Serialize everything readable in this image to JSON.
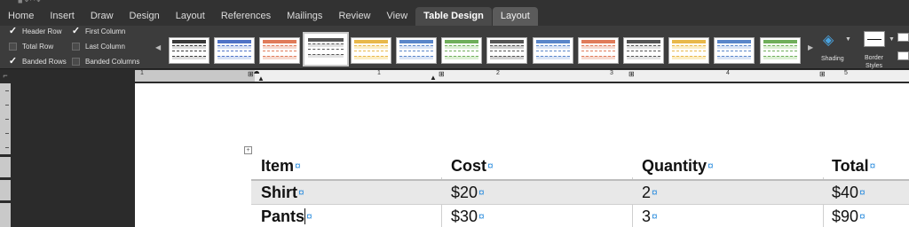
{
  "ribbon_tabs": [
    "Home",
    "Insert",
    "Draw",
    "Design",
    "Layout",
    "References",
    "Mailings",
    "Review",
    "View",
    "Table Design",
    "Layout"
  ],
  "active_tab": "Table Design",
  "table_style_options": {
    "header_row": "Header Row",
    "first_column": "First Column",
    "total_row": "Total Row",
    "last_column": "Last Column",
    "banded_rows": "Banded Rows",
    "banded_columns": "Banded Columns",
    "checked": [
      "Header Row",
      "First Column",
      "Banded Rows"
    ]
  },
  "table_styles": {
    "count": 14,
    "selected_index": 3,
    "row_colors": [
      "#3a3a3a",
      "#4f73c6",
      "#e07b5a",
      "#555555",
      "#e8b84a",
      "#5a86c9",
      "#6fae5a",
      "#555555",
      "#5a86c9",
      "#e07b5a",
      "#555555",
      "#e8b84a",
      "#5a86c9",
      "#6fae5a"
    ],
    "band_colors": [
      "#dcdcdc",
      "#d6e0f4",
      "#f6d9cf",
      "#e2e2e2",
      "#fbedc4",
      "#d9e4f5",
      "#dcefd4",
      "#cfcfcf",
      "#d9e4f5",
      "#f6d9cf",
      "#e2e2e2",
      "#fbedc4",
      "#d9e4f5",
      "#dcefd4"
    ]
  },
  "tools": {
    "shading": "Shading",
    "border_styles": "Border\nStyles"
  },
  "ruler_numbers": [
    "1",
    "1",
    "2",
    "3",
    "4",
    "5"
  ],
  "table": {
    "headers": [
      "Item",
      "Cost",
      "Quantity",
      "Total"
    ],
    "rows": [
      [
        "Shirt",
        "$20",
        "2",
        "$40"
      ],
      [
        "Pants",
        "$30",
        "3",
        "$90"
      ]
    ],
    "cell_end_mark": "¤"
  }
}
